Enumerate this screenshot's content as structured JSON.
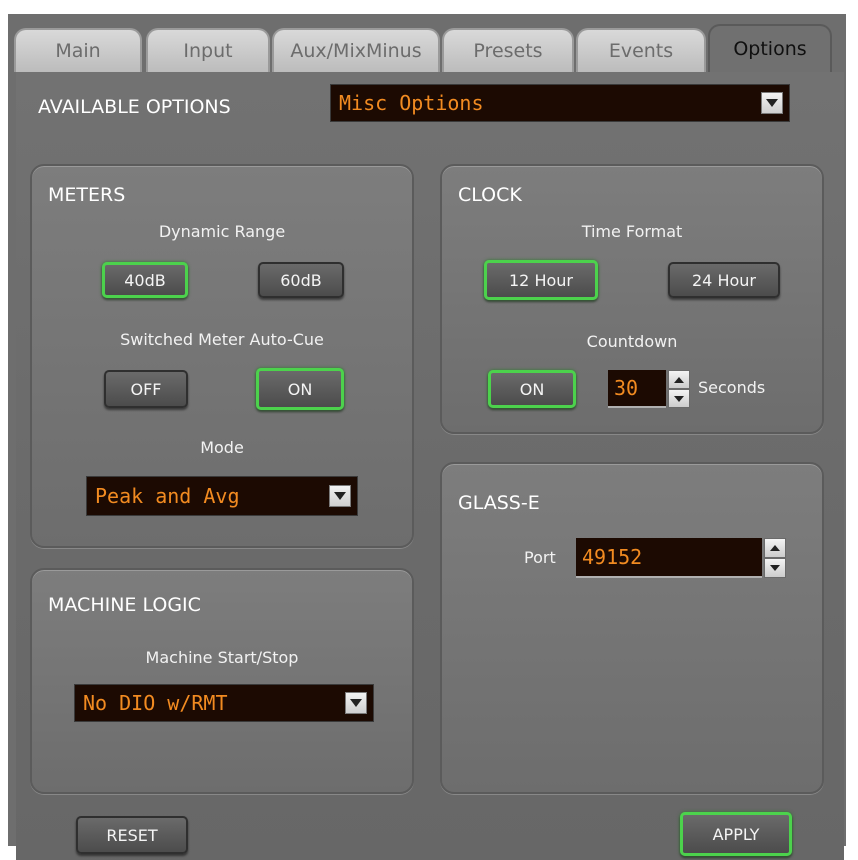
{
  "tabs": [
    {
      "label": "Main"
    },
    {
      "label": "Input"
    },
    {
      "label": "Aux/MixMinus"
    },
    {
      "label": "Presets"
    },
    {
      "label": "Events"
    },
    {
      "label": "Options"
    }
  ],
  "active_tab": "Options",
  "available_options": {
    "label": "AVAILABLE OPTIONS",
    "selected": "Misc Options"
  },
  "meters": {
    "title": "METERS",
    "dynamic_range_label": "Dynamic Range",
    "btn_40db": "40dB",
    "btn_60db": "60dB",
    "auto_cue_label": "Switched Meter Auto-Cue",
    "btn_off": "OFF",
    "btn_on": "ON",
    "mode_label": "Mode",
    "mode_selected": "Peak and Avg"
  },
  "clock": {
    "title": "CLOCK",
    "time_format_label": "Time Format",
    "btn_12h": "12 Hour",
    "btn_24h": "24 Hour",
    "countdown_label": "Countdown",
    "btn_on": "ON",
    "countdown_value": "30",
    "seconds_label": "Seconds"
  },
  "machine_logic": {
    "title": "MACHINE LOGIC",
    "start_stop_label": "Machine Start/Stop",
    "selected": "No DIO w/RMT"
  },
  "glass_e": {
    "title": "GLASS-E",
    "port_label": "Port",
    "port_value": "49152"
  },
  "footer": {
    "reset": "RESET",
    "apply": "APPLY"
  },
  "colors": {
    "active_border": "#4cd24c",
    "field_text": "#f28b21",
    "field_bg": "#1c0a02"
  }
}
